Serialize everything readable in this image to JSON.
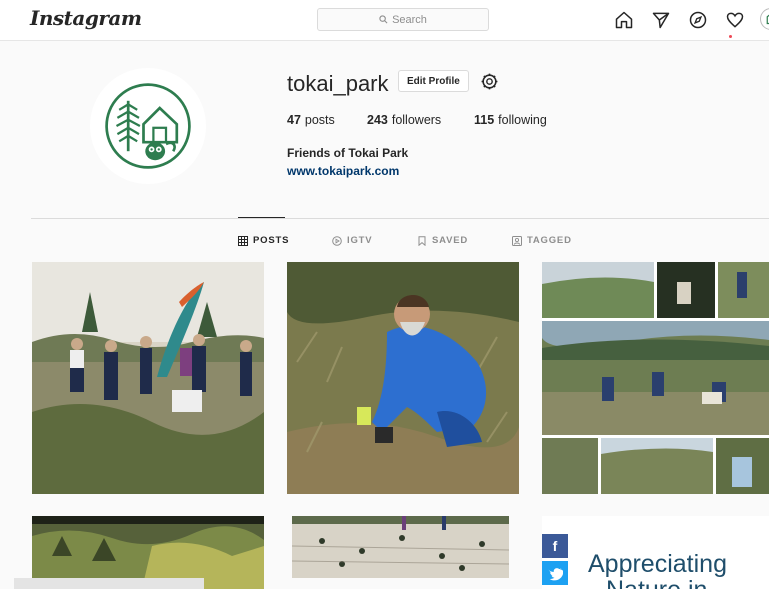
{
  "app": {
    "logo_text": "Instagram"
  },
  "search": {
    "placeholder": "Search"
  },
  "nav": {
    "icons": [
      "home-icon",
      "direct-icon",
      "explore-icon",
      "activity-heart-icon",
      "profile-avatar-icon"
    ],
    "notification_count": "1"
  },
  "profile": {
    "username": "tokai_park",
    "edit_label": "Edit Profile",
    "posts_count": "47",
    "posts_label": "posts",
    "followers_count": "243",
    "followers_label": "followers",
    "following_count": "115",
    "following_label": "following",
    "full_name": "Friends of Tokai Park",
    "website": "www.tokaipark.com"
  },
  "tabs": [
    {
      "label": "POSTS",
      "icon": "grid-icon",
      "active": true
    },
    {
      "label": "IGTV",
      "icon": "igtv-icon",
      "active": false
    },
    {
      "label": "SAVED",
      "icon": "bookmark-icon",
      "active": false
    },
    {
      "label": "TAGGED",
      "icon": "tagged-icon",
      "active": false
    }
  ],
  "posts": [
    {
      "kind": "photo",
      "subject": "volunteer-group-with-flag"
    },
    {
      "kind": "photo",
      "subject": "man-planting-seedling"
    },
    {
      "kind": "photo",
      "subject": "planting-collage"
    },
    {
      "kind": "photo",
      "subject": "fynbos-shrubs"
    },
    {
      "kind": "photo",
      "subject": "sandy-ground-seedlings"
    },
    {
      "kind": "graphic",
      "text_line1": "Appreciating",
      "text_line2": "Nature in"
    }
  ],
  "colors": {
    "accent_red": "#ed4956",
    "link_blue": "#00376b",
    "brand_green": "#2e7d4f"
  }
}
